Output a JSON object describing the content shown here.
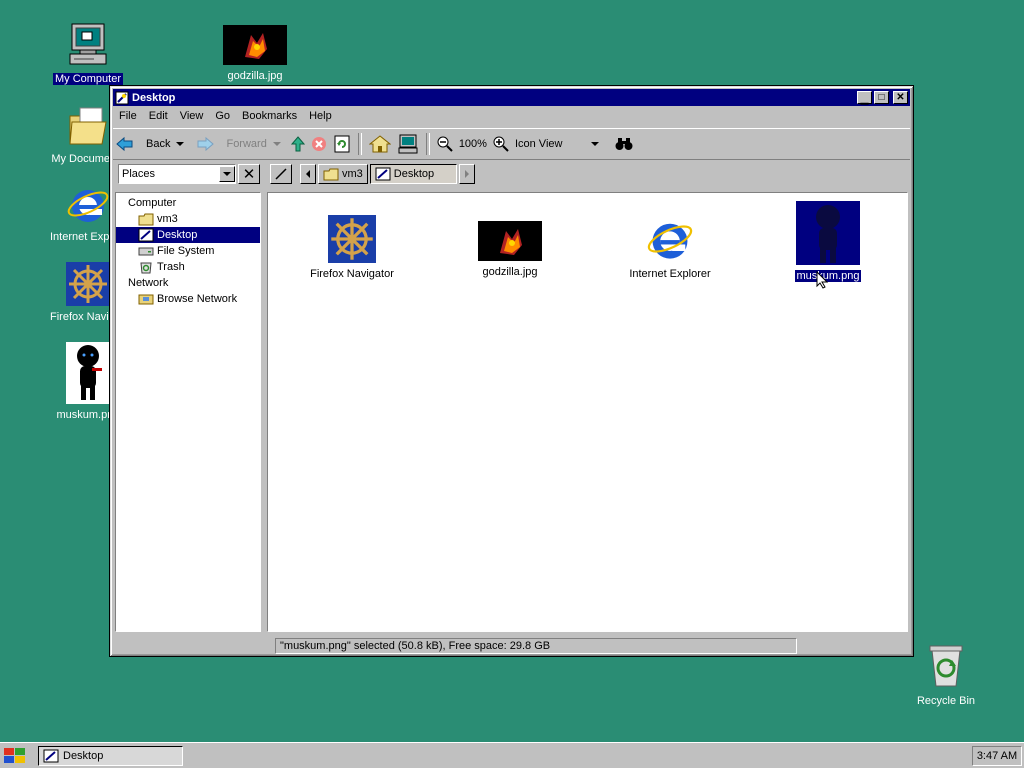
{
  "desktop": {
    "icons": [
      {
        "label": "My Computer",
        "selected": true,
        "icon": "computer-icon"
      },
      {
        "label": "godzilla.jpg",
        "icon": "image-thumbnail-icon"
      },
      {
        "label": "My Documents",
        "icon": "folder-icon"
      },
      {
        "label": "Internet Explorer",
        "icon": "internet-explorer-icon"
      },
      {
        "label": "Firefox Navigator",
        "icon": "ships-wheel-icon"
      },
      {
        "label": "muskum.png",
        "icon": "figure-thumbnail-icon"
      },
      {
        "label": "Recycle Bin",
        "icon": "recycle-bin-icon"
      }
    ]
  },
  "window": {
    "title": "Desktop",
    "menu": [
      "File",
      "Edit",
      "View",
      "Go",
      "Bookmarks",
      "Help"
    ],
    "toolbar": {
      "back": "Back",
      "forward": "Forward",
      "zoom": "100%",
      "view_mode": "Icon View"
    },
    "places_label": "Places",
    "breadcrumbs": [
      "vm3",
      "Desktop"
    ],
    "sidebar": [
      {
        "label": "Computer",
        "type": "header"
      },
      {
        "label": "vm3",
        "type": "child",
        "icon": "home-folder-icon"
      },
      {
        "label": "Desktop",
        "type": "child",
        "icon": "desktop-icon",
        "selected": true
      },
      {
        "label": "File System",
        "type": "child",
        "icon": "drive-icon"
      },
      {
        "label": "Trash",
        "type": "child",
        "icon": "trash-icon"
      },
      {
        "label": "Network",
        "type": "header"
      },
      {
        "label": "Browse Network",
        "type": "child",
        "icon": "network-icon"
      }
    ],
    "files": [
      {
        "label": "Firefox Navigator",
        "icon": "ships-wheel-icon"
      },
      {
        "label": "godzilla.jpg",
        "icon": "image-thumbnail-icon"
      },
      {
        "label": "Internet Explorer",
        "icon": "internet-explorer-icon"
      },
      {
        "label": "muskum.png",
        "icon": "figure-thumbnail-icon",
        "selected": true
      }
    ],
    "status": "\"muskum.png\" selected (50.8 kB), Free space: 29.8 GB"
  },
  "taskbar": {
    "task": "Desktop",
    "clock": "3:47 AM"
  },
  "colors": {
    "desktop_bg": "#2a8d74",
    "selection": "#000080",
    "titlebar": "#000080",
    "face": "#c0c0c0"
  }
}
